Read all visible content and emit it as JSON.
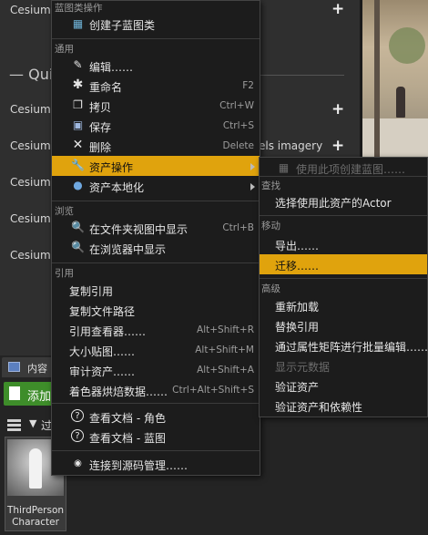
{
  "background": {
    "rows": [
      "Cesium C",
      "Cesium V",
      "Cesium V",
      "Cesium V",
      "Cesium V",
      "Cesium C"
    ],
    "quick_label": "Quic",
    "imagery_text": "els imagery",
    "plus": "+"
  },
  "content_browser": {
    "tab_label": "内容",
    "add_label": "添加",
    "filter_label": "过",
    "filter_icon": "▼",
    "asset_name": "ThirdPerson Character"
  },
  "menu": {
    "title": "蓝图类操作",
    "create_child": "创建子蓝图类",
    "sections": {
      "general": "通用",
      "browse": "浏览",
      "references": "引用"
    },
    "items": {
      "edit": {
        "label": "编辑……",
        "shortcut": ""
      },
      "rename": {
        "label": "重命名",
        "shortcut": "F2"
      },
      "copy": {
        "label": "拷贝",
        "shortcut": "Ctrl+W"
      },
      "save": {
        "label": "保存",
        "shortcut": "Ctrl+S"
      },
      "delete": {
        "label": "删除",
        "shortcut": "Delete"
      },
      "asset_actions": {
        "label": "资产操作"
      },
      "asset_localization": {
        "label": "资产本地化"
      },
      "show_in_folder": {
        "label": "在文件夹视图中显示",
        "shortcut": "Ctrl+B"
      },
      "show_in_browser": {
        "label": "在浏览器中显示",
        "shortcut": ""
      },
      "copy_reference": {
        "label": "复制引用",
        "shortcut": ""
      },
      "copy_file_path": {
        "label": "复制文件路径",
        "shortcut": ""
      },
      "reference_viewer": {
        "label": "引用查看器……",
        "shortcut": "Alt+Shift+R"
      },
      "size_map": {
        "label": "大小贴图……",
        "shortcut": "Alt+Shift+M"
      },
      "audit_assets": {
        "label": "审计资产……",
        "shortcut": "Alt+Shift+A"
      },
      "shader_cook": {
        "label": "着色器烘焙数据……",
        "shortcut": "Ctrl+Alt+Shift+S"
      },
      "doc_character": {
        "label": "查看文档 - 角色"
      },
      "doc_blueprint": {
        "label": "查看文档 - 蓝图"
      },
      "source_control": {
        "label": "连接到源码管理……"
      }
    }
  },
  "submenu": {
    "create_blueprint": "使用此项创建蓝图……",
    "sections": {
      "find": "查找",
      "move": "移动",
      "advanced": "高级"
    },
    "items": {
      "select_actor": "选择使用此资产的Actor",
      "export": "导出……",
      "migrate": "迁移……",
      "reload": "重新加载",
      "replace_references": "替换引用",
      "bulk_edit": "通过属性矩阵进行批量编辑……",
      "show_metadata": "显示元数据",
      "validate": "验证资产",
      "validate_deps": "验证资产和依赖性"
    }
  },
  "colors": {
    "highlight": "#e0a30d",
    "menu_bg": "#1c1c1c",
    "add_button": "#3e8d2a"
  }
}
